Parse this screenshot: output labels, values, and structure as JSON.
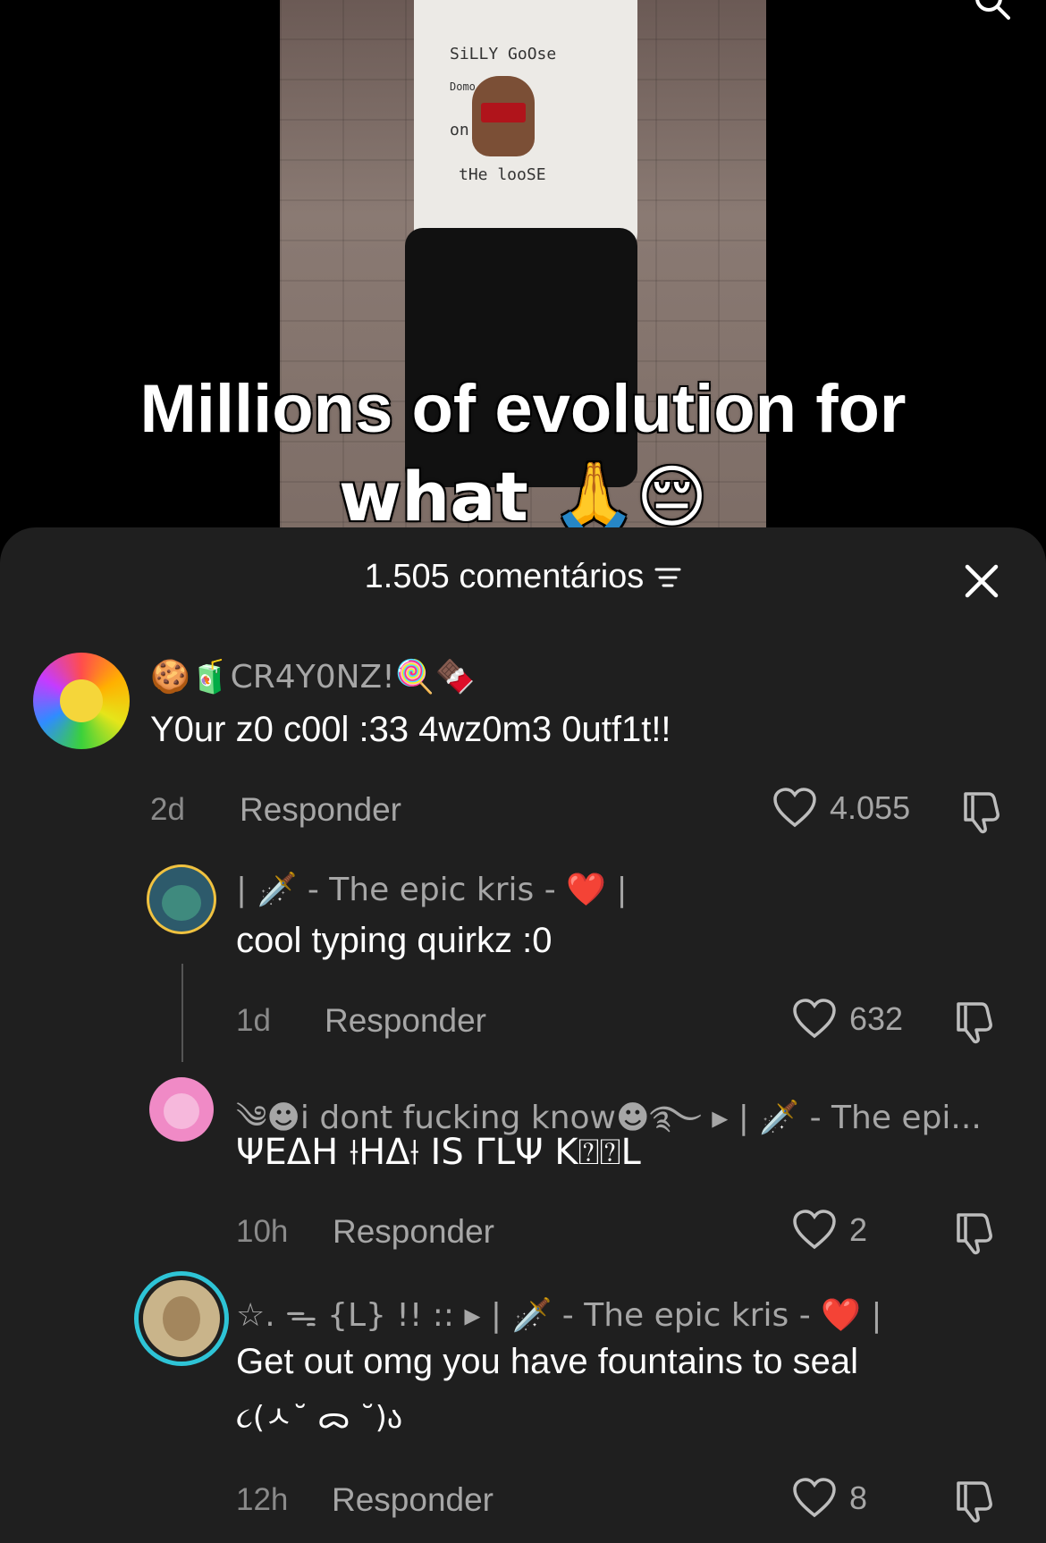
{
  "video": {
    "caption_line1": "Millions of evolution for",
    "caption_line2": "what 🙏😔",
    "shirt_text_top": "SiLLY GoOse",
    "shirt_text_domo": "Domo",
    "shirt_text_on": "on",
    "shirt_text_bottom": "tHe looSE"
  },
  "comments_header": {
    "count_label": "1.505 comentários"
  },
  "comments": [
    {
      "name": "🍪🧃CR4Y0NZ!🍭🍫",
      "text": "Y0ur z0 c00l :33 4wz0m3 0utf1t!!",
      "age": "2d",
      "reply_label": "Responder",
      "likes": "4.055",
      "avatar_color": "#e9c23b"
    },
    {
      "name": "| 🗡️ - The epic kris - ❤️ |",
      "text": "cool typing quirkz :0",
      "age": "1d",
      "reply_label": "Responder",
      "likes": "632",
      "avatar_color": "#2d5a6b"
    },
    {
      "name": "༄☻︎i dont fucking know☻︎࿐ ▸ | 🗡️ - The epi...",
      "text": "ΨΕΔΗ ⟊ΗΔ⟊ ΙЅ ΓLΨ Κ⍰⍰L",
      "age": "10h",
      "reply_label": "Responder",
      "likes": "2",
      "avatar_color": "#f08ac6"
    },
    {
      "name": "☆. ᯓ {L} !! :: ▸ | 🗡️ - The epic kris - ❤️ |",
      "text_line1": "Get out omg you have fountains to seal",
      "text_line2": "૮(ㅅ˘ ᯅ ˘)ა",
      "age": "12h",
      "reply_label": "Responder",
      "likes": "8",
      "avatar_color": "#c9b48a",
      "ring_color": "#2ec4d6"
    }
  ],
  "colors": {
    "sheet_bg": "#1f1f1f",
    "muted_text": "#a6a6a6",
    "story_ring": "#2ec4d6"
  },
  "icons": [
    "search-icon",
    "filter-icon",
    "close-icon",
    "heart-icon",
    "dislike-icon"
  ]
}
